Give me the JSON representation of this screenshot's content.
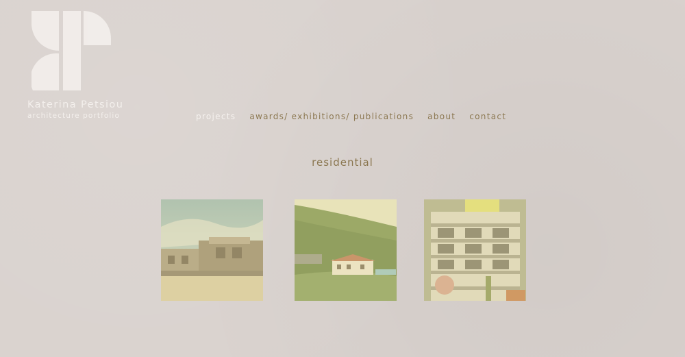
{
  "header": {
    "name": "Katerina Petsiou",
    "subtitle": "architecture portfolio",
    "logo_icon": "kp-monogram-icon"
  },
  "nav": {
    "items": [
      {
        "label": "projects",
        "active": true
      },
      {
        "label": "awards/ exhibitions/ publications",
        "active": false
      },
      {
        "label": "about",
        "active": false
      },
      {
        "label": "contact",
        "active": false
      }
    ]
  },
  "main": {
    "section_title": "residential",
    "thumbnails": [
      {
        "subject": "stone-villa-photo"
      },
      {
        "subject": "hillside-house-photo"
      },
      {
        "subject": "apartment-building-photo"
      }
    ]
  },
  "colors": {
    "background": "#d9d2ce",
    "nav_text": "#8b7750",
    "logo": "#f3efec",
    "photo_tint": "#e8dea0"
  }
}
